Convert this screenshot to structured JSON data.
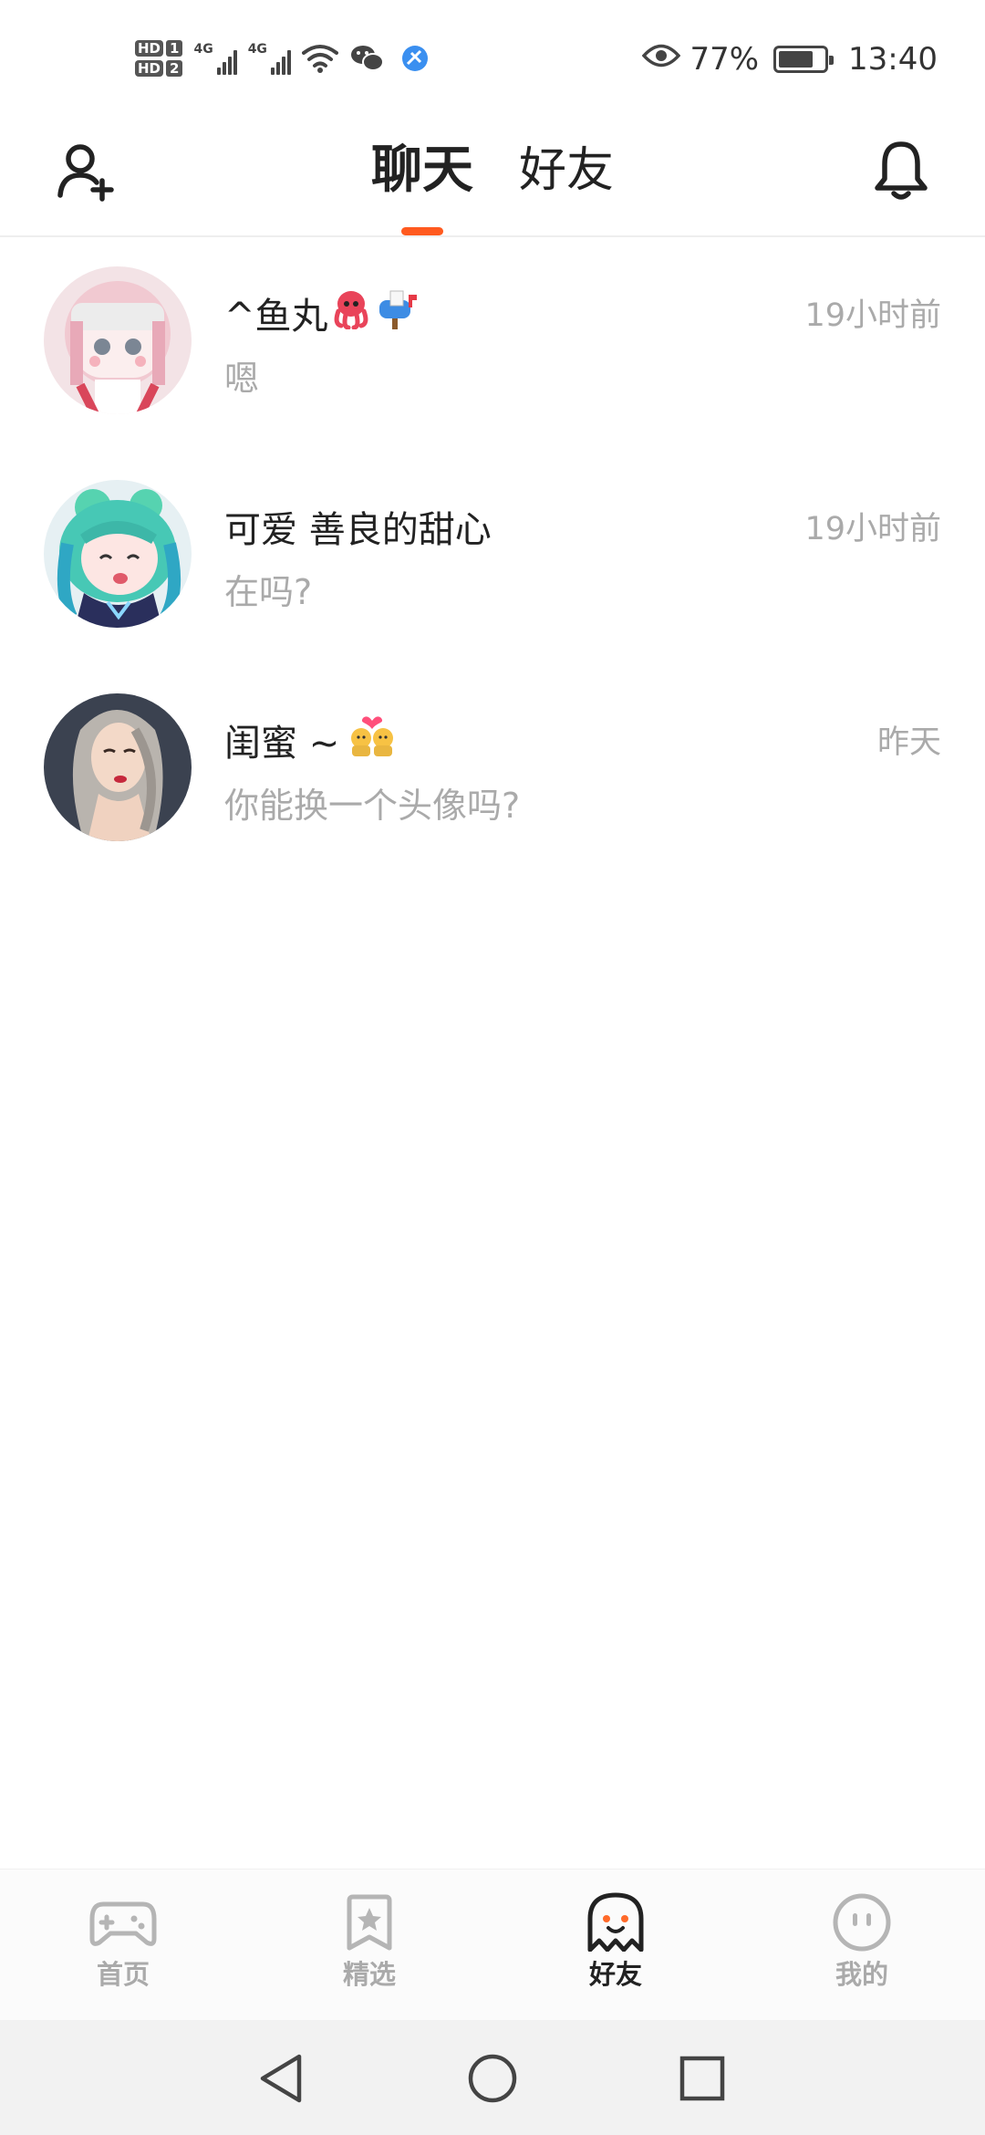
{
  "status_bar": {
    "hd_labels": [
      "HD",
      "HD"
    ],
    "sim_numbers": [
      "1",
      "2"
    ],
    "network_labels": [
      "4G",
      "4G"
    ],
    "battery_percent": "77%",
    "battery_level": 0.77,
    "time": "13:40"
  },
  "header": {
    "tabs": [
      {
        "label": "聊天",
        "active": true
      },
      {
        "label": "好友",
        "active": false
      }
    ],
    "accent_color": "#ff5a1f"
  },
  "chats": [
    {
      "name": "^鱼丸",
      "emojis": [
        "octopus",
        "mailbox"
      ],
      "preview": "嗯",
      "time": "19小时前"
    },
    {
      "name": "可爱 善良的甜心",
      "emojis": [],
      "preview": "在吗?",
      "time": "19小时前"
    },
    {
      "name": "闺蜜 ~",
      "emojis": [
        "couple-with-heart"
      ],
      "preview": "你能换一个头像吗?",
      "time": "昨天"
    }
  ],
  "bottom_nav": [
    {
      "label": "首页",
      "icon": "gamepad-icon",
      "active": false
    },
    {
      "label": "精选",
      "icon": "star-bookmark-icon",
      "active": false
    },
    {
      "label": "好友",
      "icon": "ghost-icon",
      "active": true
    },
    {
      "label": "我的",
      "icon": "smiley-icon",
      "active": false
    }
  ],
  "system_nav": [
    "back-icon",
    "home-icon",
    "recents-icon"
  ]
}
